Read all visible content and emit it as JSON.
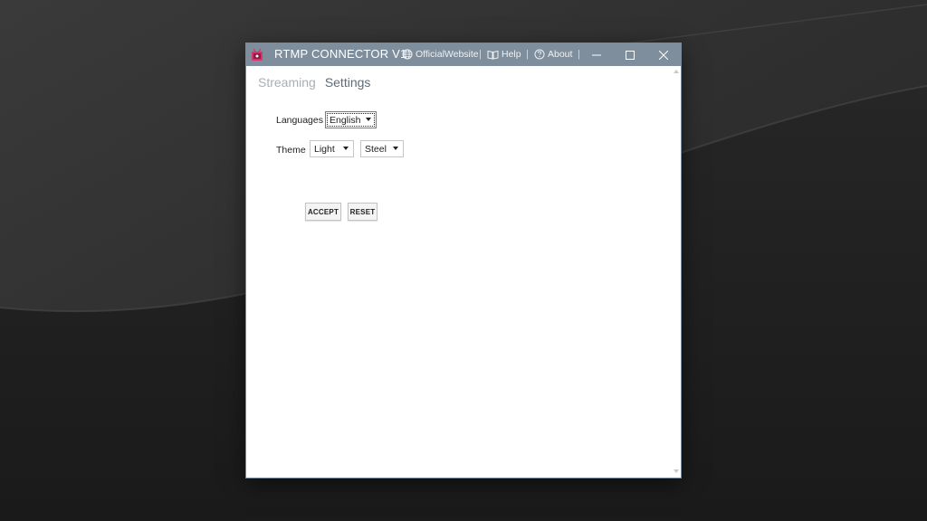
{
  "window": {
    "title": "RTMP CONNECTOR V1",
    "links": {
      "website": "OfficialWebsite",
      "help": "Help",
      "about": "About"
    },
    "separator": "|",
    "controls": [
      "minimize-icon",
      "maximize-icon",
      "close-icon"
    ]
  },
  "tabs": [
    {
      "label": "Streaming",
      "active": false
    },
    {
      "label": "Settings",
      "active": true
    }
  ],
  "settings": {
    "languages_label": "Languages",
    "language_value": "English",
    "theme_label": "Theme",
    "theme_value": "Light",
    "accent_value": "Steel"
  },
  "buttons": {
    "accept": "ACCEPT",
    "reset": "RESET"
  },
  "colors": {
    "titlebar": "#7f8e9c",
    "active_tab": "#5d6b78",
    "inactive_tab": "#a9afb4",
    "app_icon": "#d6336c"
  }
}
